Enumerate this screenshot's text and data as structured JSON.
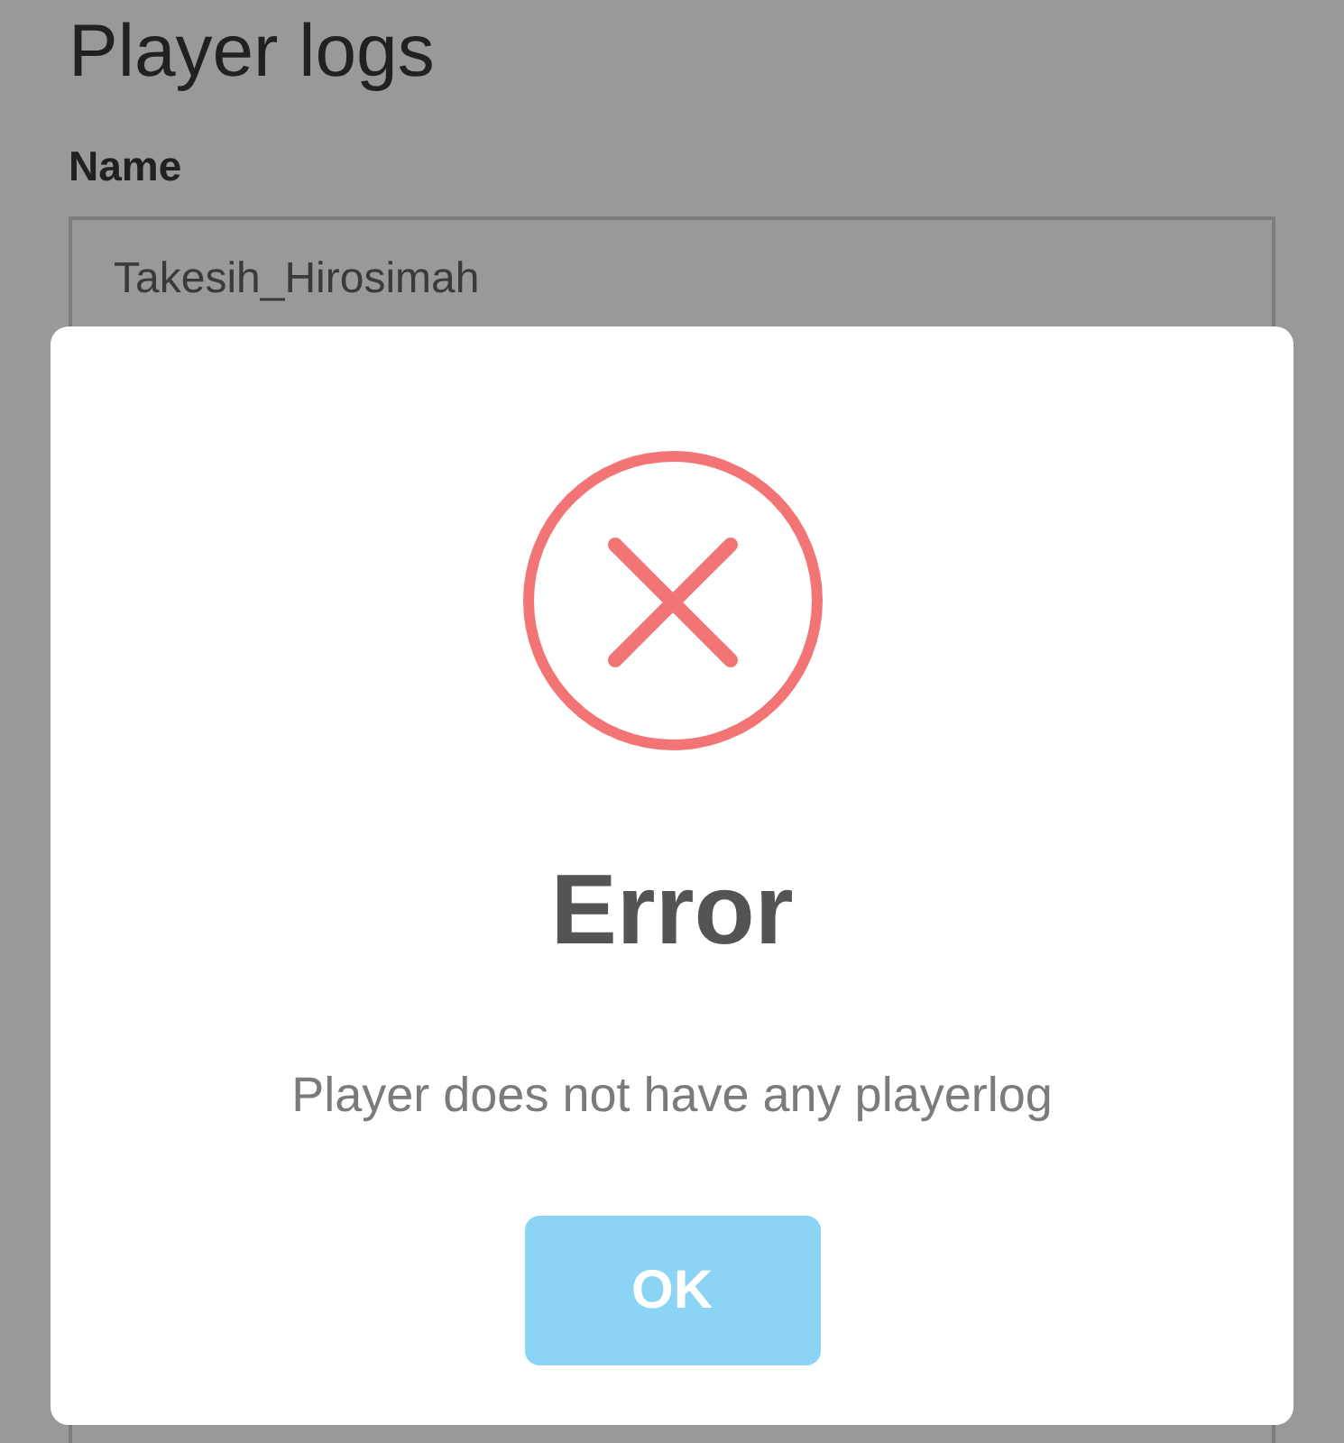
{
  "page": {
    "title": "Player logs",
    "fields": [
      {
        "label": "Name",
        "value": "Takesih_Hirosimah"
      }
    ]
  },
  "dialog": {
    "kind": "error",
    "title": "Error",
    "message": "Player does not have any playerlog",
    "buttons": [
      {
        "label": "OK"
      }
    ]
  }
}
